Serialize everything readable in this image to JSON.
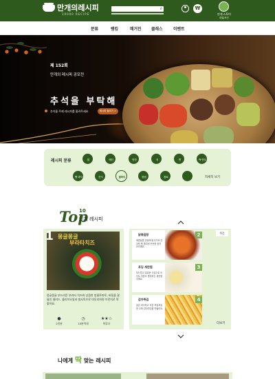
{
  "header": {
    "logo_text": "만개의레시피",
    "logo_sub": "10000 RECIPE",
    "search_placeholder": "",
    "store_label": "만개 스토어",
    "store_sub": "레벨/포인"
  },
  "nav": {
    "items": [
      "분류",
      "랭킹",
      "매거진",
      "클래스",
      "이벤트"
    ]
  },
  "hero": {
    "round": "제 152회",
    "subtitle": "만개의 레시피 공모전",
    "title": "추석을 부탁해",
    "desc": "추석을 주제 레시피를 올려주세요",
    "button": "레시피 올리기 >"
  },
  "categories": {
    "title": "레시피 분류",
    "more": "자세히 보기",
    "items": [
      "밥",
      "메인",
      "반찬",
      "국",
      "면",
      "떡·만두",
      "빵·과자",
      "간식",
      "샐러드",
      "양념",
      "음료"
    ],
    "selected": "간식"
  },
  "top10": {
    "top_word": "Top",
    "ten": "10",
    "label": "인기 레시피",
    "featured": {
      "number": "1",
      "title_line1": "몽글몽글",
      "title_line2": "부라타치즈",
      "desc": "몽글몽글 부드러운 부라타 치즈와 상큼한 방울토마토, 바질을 곁들인 샐러드. 올리브오일과 발사믹으로 마무리하면 브런치로 딱 좋아요.",
      "meta": [
        {
          "icon": "user-icon",
          "glyph": "●",
          "value": "2인분"
        },
        {
          "icon": "clock-icon",
          "glyph": "◷",
          "value": "10분이내"
        },
        {
          "icon": "star-icon",
          "glyph": "★★☆",
          "value": "아무나"
        }
      ]
    },
    "list": [
      {
        "number": "2",
        "title": "닭볶음탕",
        "desc": "매콤달콤 양념에 닭고기와 감자를 푹 졸여낸 든든한 한끼 요리예요."
      },
      {
        "number": "3",
        "title": "푸딩 계란찜",
        "desc": "부드럽고 촉촉한 식감으로 아이도 어른도 좋아하는 계란찜이에요."
      },
      {
        "number": "4",
        "title": "감자튀김",
        "desc": "겉은 바삭하고 속은 포슬포슬한 수제 감자튀김을 만들어요."
      }
    ],
    "tag": "주간",
    "more": "더보기"
  },
  "fit": {
    "pre": "나에게",
    "accent": "딱",
    "post": "맞는 레시피"
  },
  "colors": {
    "brand": "#2f5a1d",
    "light": "#e5f2d6",
    "accent": "#6bb42c"
  }
}
